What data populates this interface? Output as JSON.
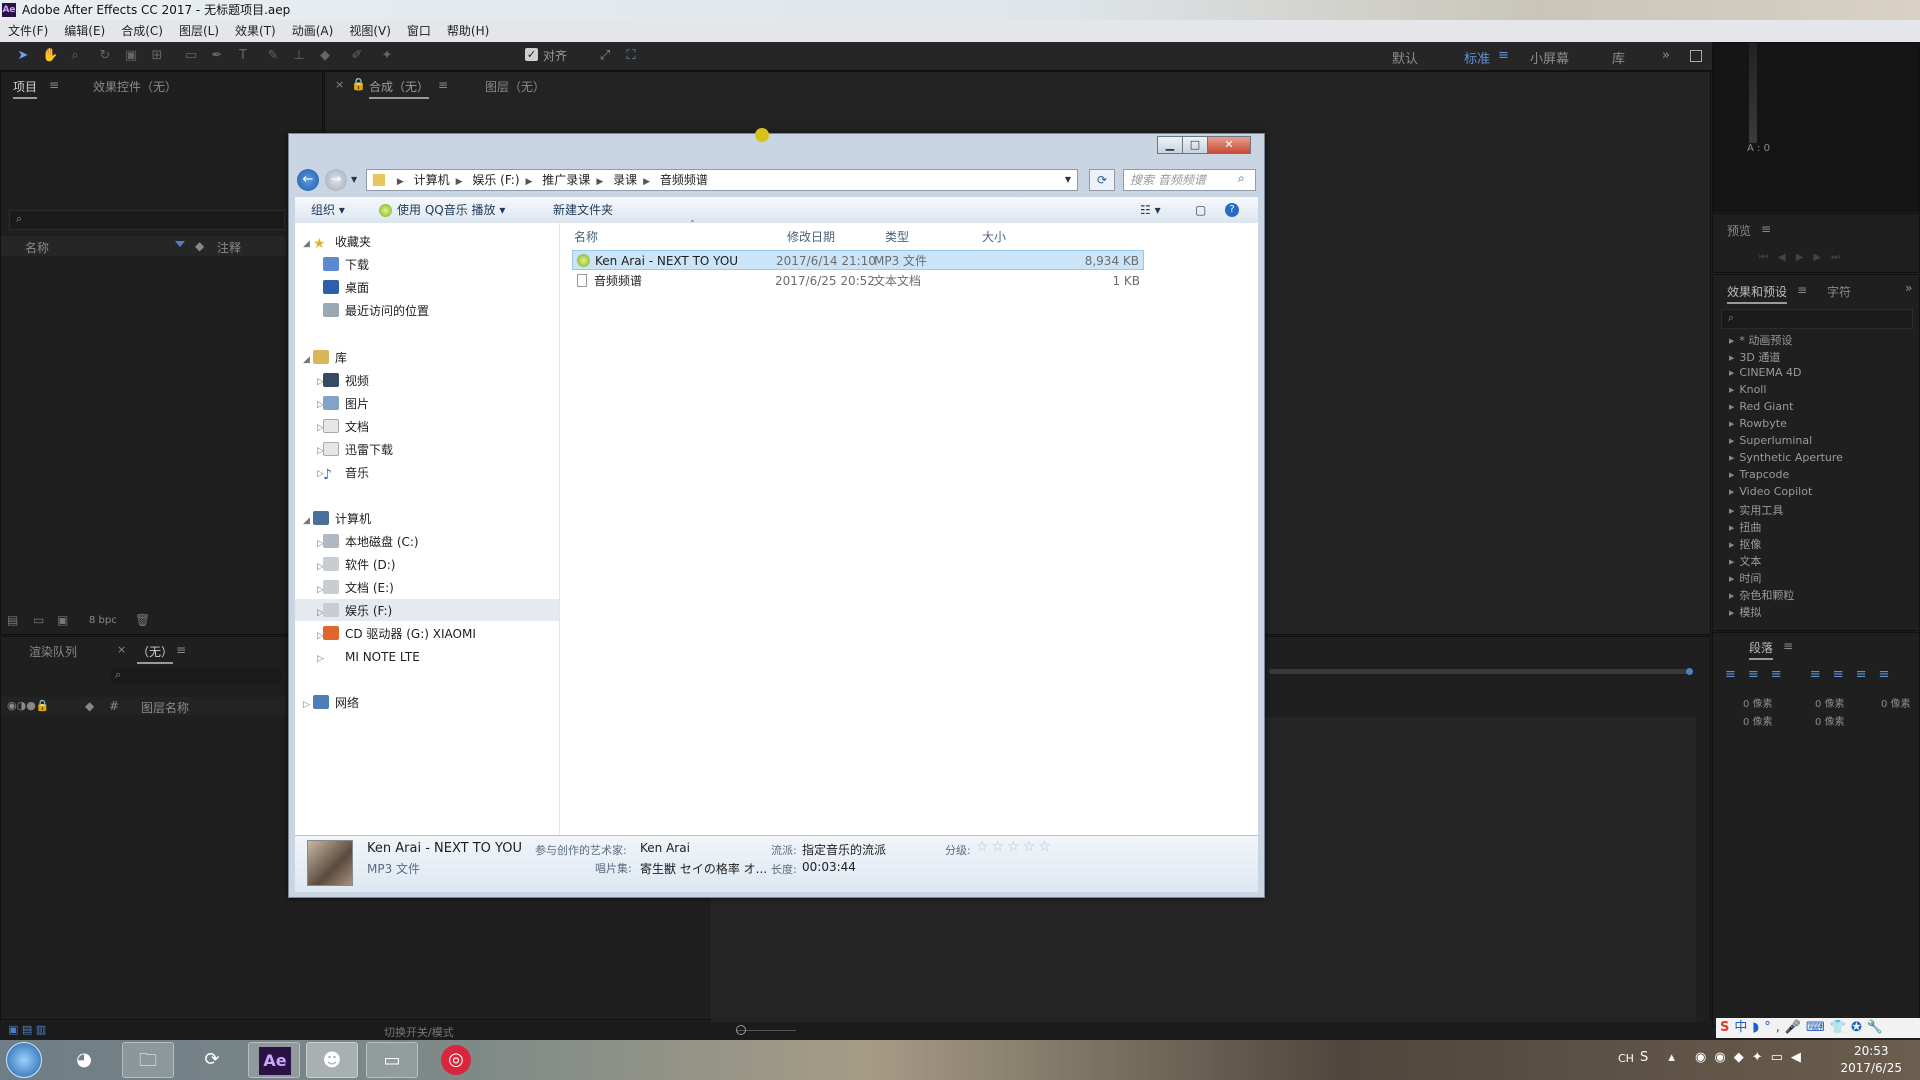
{
  "app": {
    "title": "Adobe After Effects CC 2017 - 无标题项目.aep",
    "menu": [
      "文件(F)",
      "编辑(E)",
      "合成(C)",
      "图层(L)",
      "效果(T)",
      "动画(A)",
      "视图(V)",
      "窗口",
      "帮助(H)"
    ],
    "snap_label": "对齐",
    "workspaces": [
      "默认",
      "标准",
      "小屏幕",
      "库"
    ],
    "active_workspace": "标准",
    "info_audio": "A : 0"
  },
  "project_panel": {
    "tab_project": "项目",
    "tab_effect_controls": "效果控件（无）",
    "col_name": "名称",
    "col_comment": "注释",
    "bpc": "8 bpc"
  },
  "composition_panel": {
    "tab_comp": "合成（无）",
    "tab_layer": "图层（无）"
  },
  "timeline": {
    "tab_render_queue": "渲染队列",
    "tab_none": "（无）",
    "col_layer_name": "图层名称",
    "toggle_label": "切换开关/模式"
  },
  "right_panels": {
    "preview_label": "预览",
    "tab_effects_presets": "效果和预设",
    "tab_character": "字符",
    "effects": [
      "* 动画预设",
      "3D 通道",
      "CINEMA 4D",
      "Knoll",
      "Red Giant",
      "Rowbyte",
      "Superluminal",
      "Synthetic Aperture",
      "Trapcode",
      "Video Copilot",
      "实用工具",
      "扭曲",
      "抠像",
      "文本",
      "时间",
      "杂色和颗粒",
      "模拟"
    ],
    "paragraph_label": "段落",
    "px_values": [
      "0 像素",
      "0 像素",
      "0 像素",
      "0 像素",
      "0 像素"
    ]
  },
  "explorer": {
    "breadcrumb": [
      "计算机",
      "娱乐 (F:)",
      "推广录课",
      "录课",
      "音频频谱"
    ],
    "search_placeholder": "搜索 音频频谱",
    "cmd_organize": "组织 ▾",
    "cmd_play": "使用 QQ音乐 播放 ▾",
    "cmd_newfolder": "新建文件夹",
    "nav": {
      "favorites": "收藏夹",
      "fav_items": [
        "下载",
        "桌面",
        "最近访问的位置"
      ],
      "libraries": "库",
      "lib_items": [
        "视频",
        "图片",
        "文档",
        "迅雷下载",
        "音乐"
      ],
      "computer": "计算机",
      "drives": [
        "本地磁盘 (C:)",
        "软件 (D:)",
        "文档 (E:)",
        "娱乐 (F:)",
        "CD 驱动器 (G:) XIAOMI",
        "MI NOTE LTE"
      ],
      "network": "网络"
    },
    "columns": {
      "name": "名称",
      "date": "修改日期",
      "type": "类型",
      "size": "大小"
    },
    "files": [
      {
        "name": "Ken Arai - NEXT TO YOU",
        "date": "2017/6/14 21:10",
        "type": "MP3 文件",
        "size": "8,934 KB"
      },
      {
        "name": "音频频谱",
        "date": "2017/6/25 20:52",
        "type": "文本文档",
        "size": "1 KB"
      }
    ],
    "details": {
      "name": "Ken Arai - NEXT TO YOU",
      "filetype": "MP3 文件",
      "artist_label": "参与创作的艺术家:",
      "artist": "Ken Arai",
      "album_label": "唱片集:",
      "album": "寄生獣 セイの格率 オ...",
      "genre_label": "流派:",
      "genre": "指定音乐的流派",
      "length_label": "长度:",
      "length": "00:03:44",
      "rating_label": "分级:"
    }
  },
  "taskbar": {
    "lang": "CH",
    "time": "20:53",
    "date": "2017/6/25"
  }
}
